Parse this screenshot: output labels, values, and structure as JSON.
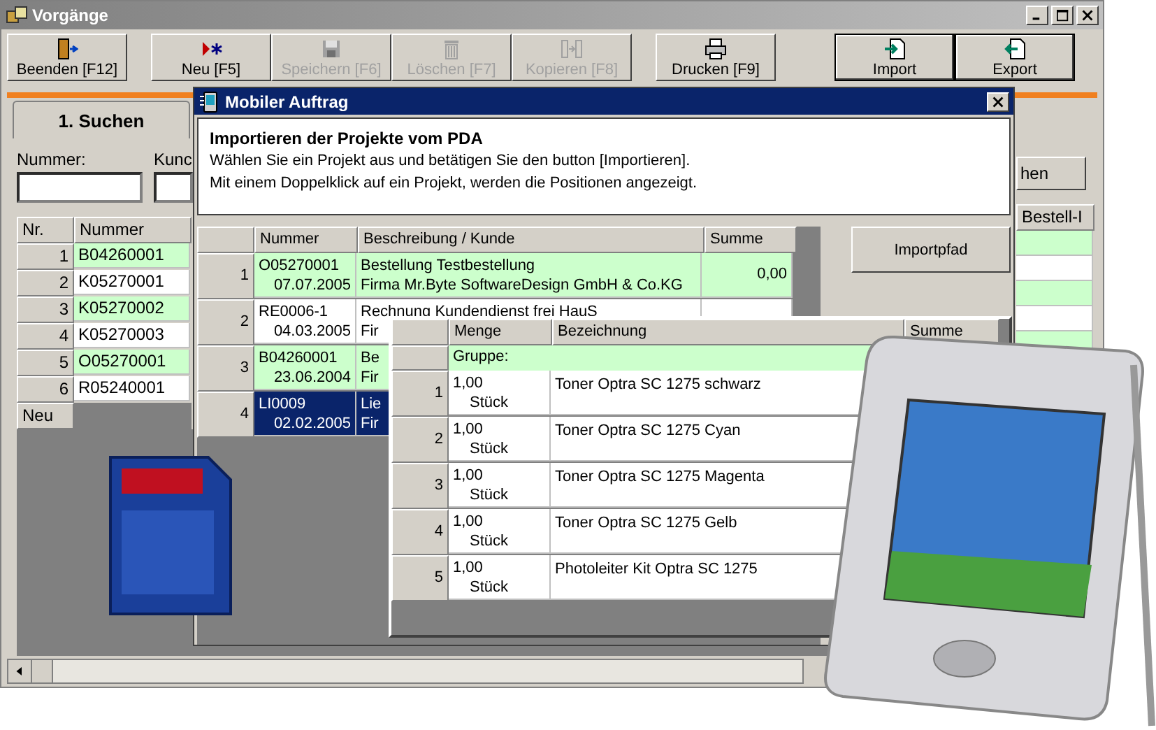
{
  "window": {
    "title": "Vorgänge"
  },
  "toolbar_groups": [
    {
      "buttons": [
        {
          "label": "Beenden [F12]",
          "disabled": false
        }
      ]
    },
    {
      "buttons": [
        {
          "label": "Neu [F5]",
          "disabled": false
        },
        {
          "label": "Speichern [F6]",
          "disabled": true
        },
        {
          "label": "Löschen [F7]",
          "disabled": true
        },
        {
          "label": "Kopieren [F8]",
          "disabled": true
        }
      ]
    },
    {
      "buttons": [
        {
          "label": "Drucken [F9]",
          "disabled": false
        }
      ]
    },
    {
      "buttons": [
        {
          "label": "Import",
          "disabled": false
        },
        {
          "label": "Export",
          "disabled": false
        }
      ]
    }
  ],
  "search_tab": {
    "label": "1. Suchen",
    "selected": true
  },
  "fields": [
    {
      "label": "Nummer:"
    },
    {
      "label": "Kunc"
    }
  ],
  "search_button_fragment": "hen",
  "table": {
    "columns": [
      "Nr.",
      "Nummer"
    ],
    "right_column": "Bestell-I",
    "new_row_label": "Neu",
    "rows": [
      {
        "nr": "1",
        "nummer": "B04260001",
        "highlighted": true
      },
      {
        "nr": "2",
        "nummer": "K05270001",
        "highlighted": false
      },
      {
        "nr": "3",
        "nummer": "K05270002",
        "highlighted": true
      },
      {
        "nr": "4",
        "nummer": "K05270003",
        "highlighted": false
      },
      {
        "nr": "5",
        "nummer": "O05270001",
        "highlighted": true
      },
      {
        "nr": "6",
        "nummer": "R05240001",
        "highlighted": false
      }
    ]
  },
  "dialog": {
    "title": "Mobiler Auftrag",
    "heading": "Importieren der Projekte vom PDA",
    "lines": [
      "Wählen Sie ein Projekt aus und betätigen Sie den button [Importieren].",
      "Mit einem Doppelklick auf ein Projekt, werden die Positionen angezeigt."
    ],
    "import_path_button": "Importpfad",
    "columns": [
      "Nummer",
      "Beschreibung / Kunde",
      "Summe"
    ],
    "rows": [
      {
        "nr": "1",
        "nummer": "O05270001",
        "date": "07.07.2005",
        "description": "Bestellung Testbestellung",
        "customer": "Firma Mr.Byte SoftwareDesign GmbH & Co.KG",
        "sum": "0,00",
        "highlighted": true,
        "selected": false
      },
      {
        "nr": "2",
        "nummer": "RE0006-1",
        "date": "04.03.2005",
        "description": "Rechnung Kundendienst frei HauS",
        "customer": "Fir",
        "highlighted": false,
        "selected": false
      },
      {
        "nr": "3",
        "nummer": "B04260001",
        "date": "23.06.2004",
        "description": "Be",
        "customer": "Fir",
        "highlighted": true,
        "selected": false
      },
      {
        "nr": "4",
        "nummer": "LI0009",
        "date": "02.02.2005",
        "description": "Lie",
        "customer": "Fir",
        "highlighted": false,
        "selected": true
      }
    ]
  },
  "positions": {
    "columns": [
      "Menge",
      "Bezeichnung",
      "Summe"
    ],
    "group_label": "Gruppe:",
    "rows": [
      {
        "nr": "1",
        "qty": "1,00",
        "unit": "Stück",
        "name": "Toner Optra SC 1275 schwarz"
      },
      {
        "nr": "2",
        "qty": "1,00",
        "unit": "Stück",
        "name": "Toner Optra SC 1275 Cyan"
      },
      {
        "nr": "3",
        "qty": "1,00",
        "unit": "Stück",
        "name": "Toner Optra SC 1275 Magenta"
      },
      {
        "nr": "4",
        "qty": "1,00",
        "unit": "Stück",
        "name": "Toner Optra SC 1275 Gelb"
      },
      {
        "nr": "5",
        "qty": "1,00",
        "unit": "Stück",
        "name": "Photoleiter Kit Optra SC 1275"
      }
    ]
  }
}
